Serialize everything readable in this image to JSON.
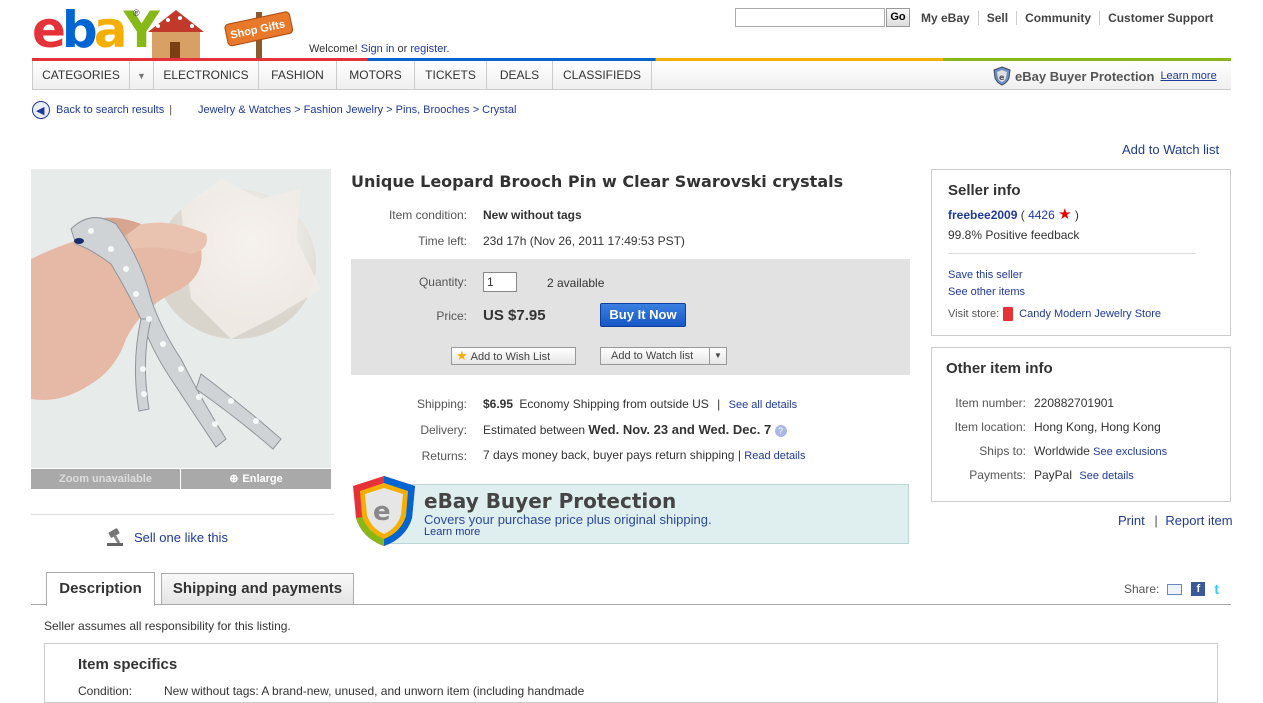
{
  "header": {
    "logo": {
      "letters": [
        "e",
        "b",
        "a",
        "Y"
      ],
      "colors": [
        "#e53238",
        "#0064d2",
        "#f5af02",
        "#86b817"
      ],
      "trademark": "®"
    },
    "promo_sign": "Shop Gifts",
    "welcome": "Welcome!",
    "sign_in": "Sign in",
    "or": "or",
    "register": "register.",
    "search_placeholder": "",
    "go_label": "Go",
    "top_links": [
      "My eBay",
      "Sell",
      "Community",
      "Customer Support"
    ]
  },
  "nav": {
    "items": [
      "CATEGORIES",
      "ELECTRONICS",
      "FASHION",
      "MOTORS",
      "TICKETS",
      "DEALS",
      "CLASSIFIEDS"
    ],
    "buyer_protection": "eBay Buyer Protection",
    "learn_more": "Learn more"
  },
  "breadcrumb": {
    "back": "Back to search results",
    "separator": "|",
    "path": "Jewelry & Watches > Fashion Jewelry > Pins, Brooches > Crystal"
  },
  "watch_top": "Add to Watch list",
  "image_panel": {
    "zoom": "Zoom unavailable",
    "enlarge": "Enlarge",
    "sell_like": "Sell one like this"
  },
  "item": {
    "title": "Unique Leopard Brooch Pin w Clear Swarovski crystals",
    "condition_label": "Item condition:",
    "condition_value": "New without tags",
    "time_label": "Time left:",
    "time_value": "23d 17h (Nov 26, 2011 17:49:53 PST)",
    "quantity_label": "Quantity:",
    "quantity_value": "1",
    "available": "2 available",
    "price_label": "Price:",
    "price_value": "US $7.95",
    "buy_now": "Buy It Now",
    "wish_list": "Add to Wish List",
    "watch_list": "Add to Watch list",
    "shipping_label": "Shipping:",
    "shipping_cost": "$6.95",
    "shipping_method": "Economy Shipping from outside US",
    "shipping_sep": "|",
    "see_all": "See all details",
    "delivery_label": "Delivery:",
    "delivery_prefix": "Estimated between",
    "delivery_dates": "Wed. Nov. 23 and Wed. Dec. 7",
    "returns_label": "Returns:",
    "returns_value": "7 days money back, buyer pays return shipping",
    "returns_sep": "|",
    "read_details": "Read details"
  },
  "bp_banner": {
    "title": "eBay Buyer Protection",
    "subtitle": "Covers your purchase price plus original shipping.",
    "learn_more": "Learn more"
  },
  "seller": {
    "heading": "Seller info",
    "name": "freebee2009",
    "open_paren": "(",
    "score": "4426",
    "close_paren": ")",
    "feedback": "99.8% Positive feedback",
    "save": "Save this seller",
    "other_items": "See other items",
    "visit_store": "Visit store:",
    "store_name": "Candy Modern Jewelry Store"
  },
  "other_info": {
    "heading": "Other item info",
    "rows": [
      {
        "label": "Item number:",
        "value": "220882701901",
        "link": ""
      },
      {
        "label": "Item location:",
        "value": "Hong Kong, Hong Kong",
        "link": ""
      },
      {
        "label": "Ships to:",
        "value": "Worldwide",
        "link": "See exclusions"
      },
      {
        "label": "Payments:",
        "value": "PayPal",
        "link": "See details"
      }
    ]
  },
  "actions": {
    "print": "Print",
    "sep": "|",
    "report": "Report item"
  },
  "tabs": [
    "Description",
    "Shipping and payments"
  ],
  "share_label": "Share:",
  "disclaimer": "Seller assumes all responsibility for this listing.",
  "specs": {
    "heading": "Item specifics",
    "condition_label": "Condition:",
    "condition_text": "New without tags: A brand-new, unused, and unworn item (including handmade"
  }
}
